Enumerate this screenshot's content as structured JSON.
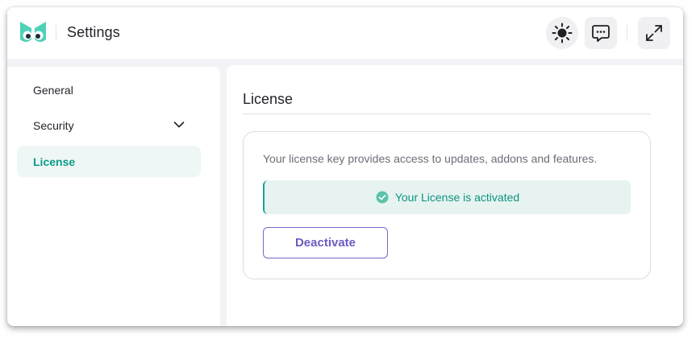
{
  "header": {
    "title": "Settings",
    "icons": {
      "logo": "owl-logo-icon",
      "theme": "sun-icon",
      "chat": "chat-bubble-icon",
      "expand": "expand-icon"
    }
  },
  "sidebar": {
    "items": [
      {
        "label": "General",
        "active": false
      },
      {
        "label": "Security",
        "active": false,
        "icon": "chevron-down-icon"
      },
      {
        "label": "License",
        "active": true
      }
    ]
  },
  "main": {
    "title": "License",
    "card": {
      "description": "Your license key provides access to updates, addons and features.",
      "status_text": "Your License is activated",
      "status_icon": "check-circle-icon",
      "button_label": "Deactivate"
    }
  },
  "colors": {
    "accent_teal": "#0c9c8a",
    "accent_purple": "#6c5cc0",
    "status_bg": "#e6f3f1",
    "window_bg": "#f3f3f7"
  }
}
